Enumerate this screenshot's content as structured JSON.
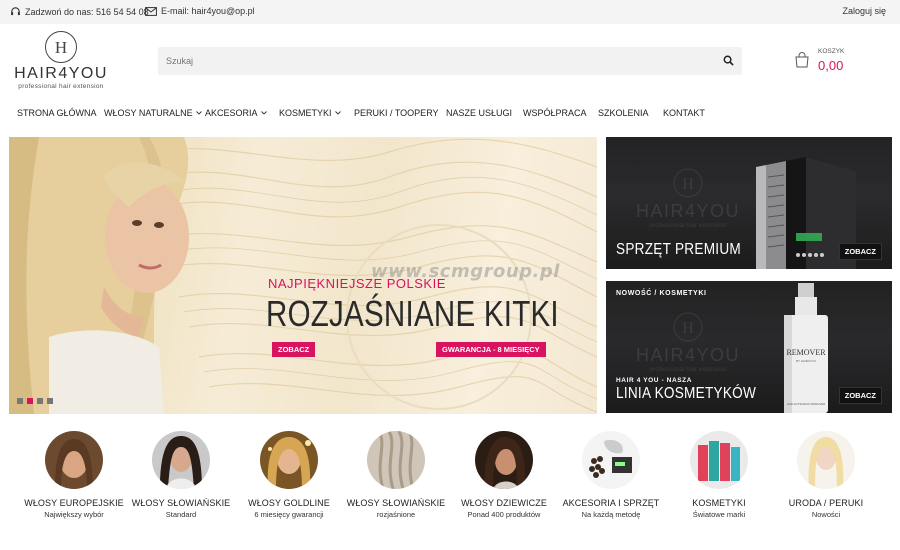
{
  "topbar": {
    "phone_label": "Zadzwoń do nas: 516 54 54 08",
    "email_label": "E-mail: hair4you@op.pl",
    "login_label": "Zaloguj się"
  },
  "logo": {
    "mark": "H",
    "name": "HAIR4YOU",
    "tagline": "professional hair extension"
  },
  "search": {
    "placeholder": "Szukaj"
  },
  "cart": {
    "label": "KOSZYK",
    "value": "0,00"
  },
  "nav": {
    "items": [
      {
        "label": "STRONA GŁÓWNA",
        "dropdown": false
      },
      {
        "label": "WŁOSY NATURALNE",
        "dropdown": true
      },
      {
        "label": "AKCESORIA",
        "dropdown": true
      },
      {
        "label": "KOSMETYKI",
        "dropdown": true
      },
      {
        "label": "PERUKI / TOOPERY",
        "dropdown": false
      },
      {
        "label": "NASZE USŁUGI",
        "dropdown": false
      },
      {
        "label": "WSPÓŁPRACA",
        "dropdown": false
      },
      {
        "label": "SZKOLENIA",
        "dropdown": false
      },
      {
        "label": "KONTAKT",
        "dropdown": false
      }
    ]
  },
  "banner": {
    "subtitle": "NAJPIĘKNIEJSZE POLSKIE",
    "title": "ROZJAŚNIANE KITKI",
    "button": "ZOBACZ",
    "badge": "GWARANCJA - 8 MIESIĘCY",
    "watermark": "www.scmgroup.pl",
    "slides": 4,
    "active_slide": 2
  },
  "promos": [
    {
      "subtitle": "",
      "title": "SPRZĘT PREMIUM",
      "button": "ZOBACZ"
    },
    {
      "subtitle": "NOWOŚĆ / KOSMETYKI",
      "subtitle2": "HAIR 4 YOU - NASZA",
      "title": "LINIA KOSMETYKÓW",
      "button": "ZOBACZ",
      "product_label": "REMOVER",
      "product_sub": "BY HAIR4YOU",
      "product_footer": "HAIR EXTENSION REMOVER"
    }
  ],
  "promo_watermark": {
    "name": "HAIR4YOU",
    "tagline": "professional hair extension"
  },
  "categories": [
    {
      "title": "WŁOSY EUROPEJSKIE",
      "subtitle": "Największy wybór"
    },
    {
      "title": "WŁOSY SŁOWIAŃSKIE",
      "subtitle": "Standard"
    },
    {
      "title": "WŁOSY GOLDLINE",
      "subtitle": "6 miesięcy gwarancji"
    },
    {
      "title": "WŁOSY SŁOWIAŃSKIE",
      "subtitle": "rozjaśnione"
    },
    {
      "title": "WŁOSY DZIEWICZE",
      "subtitle": "Ponad 400 produktów"
    },
    {
      "title": "AKCESORIA I SPRZĘT",
      "subtitle": "Na każdą metodę"
    },
    {
      "title": "KOSMETYKI",
      "subtitle": "Światowe marki"
    },
    {
      "title": "URODA / PERUKI",
      "subtitle": "Nowości"
    }
  ],
  "colors": {
    "accent": "#d8135f",
    "topbar_bg": "#f4f4f4",
    "promo_bg": "#1d1d1f"
  }
}
